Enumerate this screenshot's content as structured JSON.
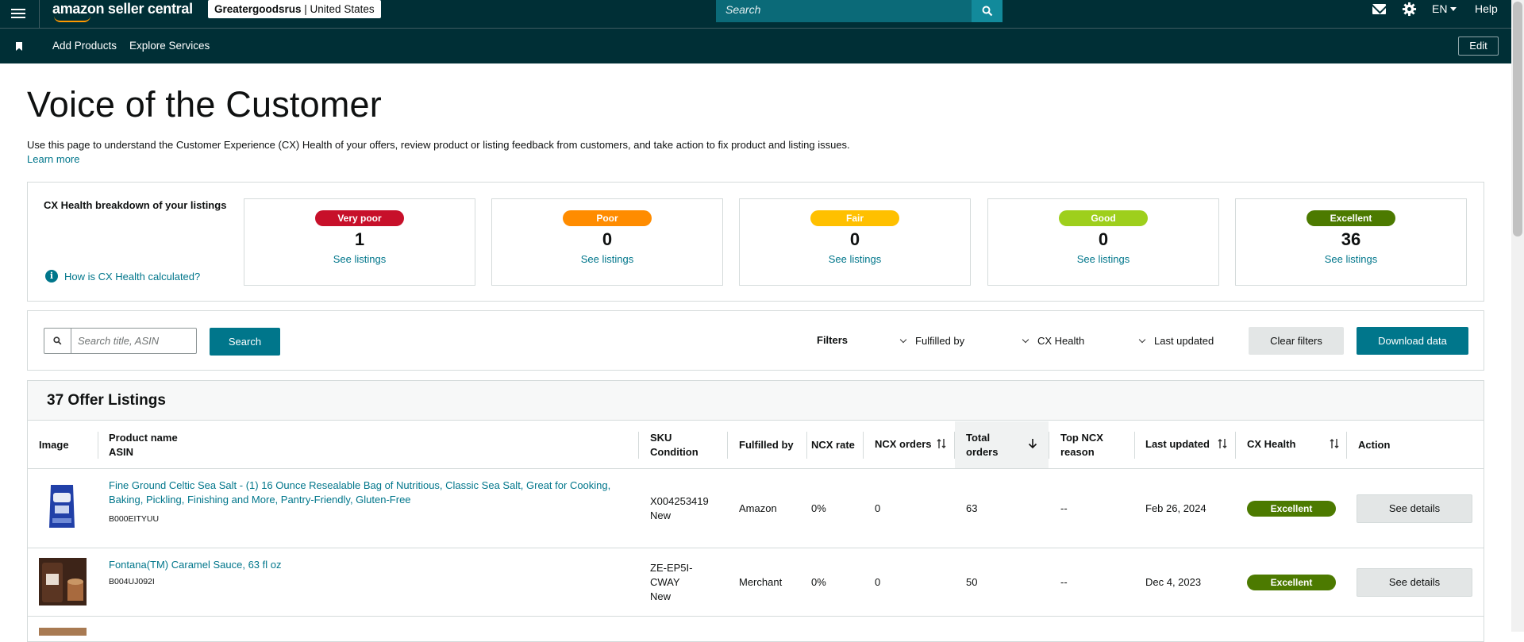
{
  "topbar": {
    "logo_text": "amazon seller central",
    "store_name": "Greatergoodsrus",
    "store_region": "United States",
    "search_placeholder": "Search",
    "language": "EN",
    "help_label": "Help"
  },
  "navbar": {
    "links": [
      "Add Products",
      "Explore Services"
    ],
    "edit_label": "Edit"
  },
  "page": {
    "title": "Voice of the Customer",
    "intro": "Use this page to understand the Customer Experience (CX) Health of your offers, review product or listing feedback from customers, and take action to fix product and listing issues.",
    "learn_more": "Learn more"
  },
  "breakdown": {
    "title": "CX Health breakdown of your listings",
    "how_calc": "How is CX Health calculated?",
    "cards": [
      {
        "label": "Very poor",
        "count": "1",
        "link": "See listings",
        "color": "#c7102a"
      },
      {
        "label": "Poor",
        "count": "0",
        "link": "See listings",
        "color": "#ff8c00"
      },
      {
        "label": "Fair",
        "count": "0",
        "link": "See listings",
        "color": "#ffc000"
      },
      {
        "label": "Good",
        "count": "0",
        "link": "See listings",
        "color": "#9ecf1c"
      },
      {
        "label": "Excellent",
        "count": "36",
        "link": "See listings",
        "color": "#4c7a00"
      }
    ]
  },
  "filterbar": {
    "search_placeholder": "Search title, ASIN",
    "search_label": "Search",
    "filters_label": "Filters",
    "dropdowns": [
      "Fulfilled by",
      "CX Health",
      "Last updated"
    ],
    "clear_label": "Clear filters",
    "download_label": "Download data"
  },
  "listings": {
    "title": "37 Offer Listings",
    "columns": {
      "image": "Image",
      "product_name": "Product name",
      "asin": "ASIN",
      "sku": "SKU",
      "condition": "Condition",
      "fulfilled_by": "Fulfilled by",
      "ncx_rate": "NCX rate",
      "ncx_orders": "NCX orders",
      "total_orders_1": "Total",
      "total_orders_2": "orders",
      "top_ncx_1": "Top NCX",
      "top_ncx_2": "reason",
      "last_updated": "Last updated",
      "cx_health": "CX Health",
      "action": "Action"
    },
    "rows": [
      {
        "name": "Fine Ground Celtic Sea Salt - (1) 16 Ounce Resealable Bag of Nutritious, Classic Sea Salt, Great for Cooking, Baking, Pickling, Finishing and More, Pantry-Friendly, Gluten-Free",
        "asin": "B000EITYUU",
        "sku": "X004253419",
        "condition": "New",
        "fulfilled_by": "Amazon",
        "ncx_rate": "0%",
        "ncx_orders": "0",
        "total_orders": "63",
        "top_ncx": "--",
        "last_updated": "Feb 26, 2024",
        "cx_health": "Excellent",
        "action": "See details"
      },
      {
        "name": "Fontana(TM) Caramel Sauce, 63 fl oz",
        "asin": "B004UJ092I",
        "sku_1": "ZE-EP5I-",
        "sku_2": "CWAY",
        "condition": "New",
        "fulfilled_by": "Merchant",
        "ncx_rate": "0%",
        "ncx_orders": "0",
        "total_orders": "50",
        "top_ncx": "--",
        "last_updated": "Dec 4, 2023",
        "cx_health": "Excellent",
        "action": "See details"
      }
    ]
  }
}
